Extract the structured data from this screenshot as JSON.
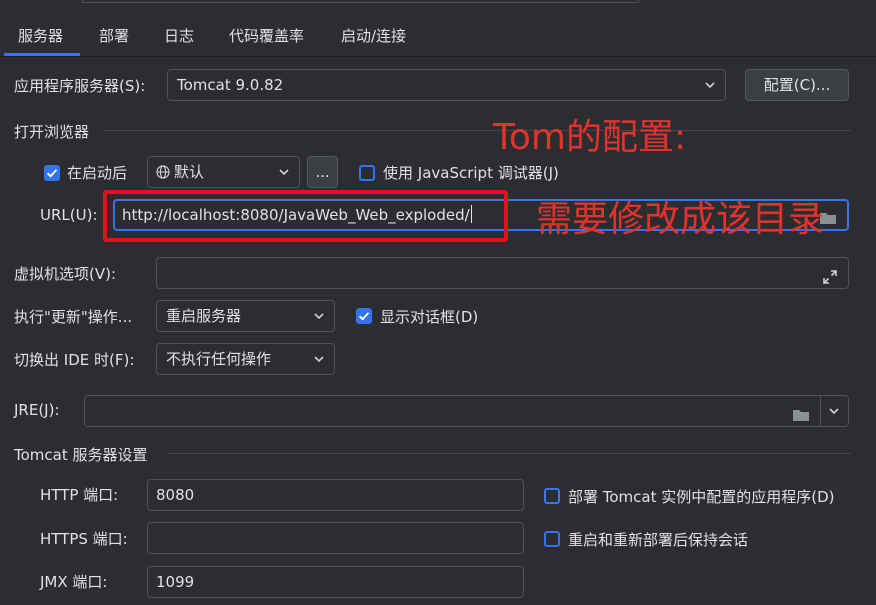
{
  "tabs": [
    "服务器",
    "部署",
    "日志",
    "代码覆盖率",
    "启动/连接"
  ],
  "server": {
    "app_server_label": "应用程序服务器(S):",
    "app_server_value": "Tomcat 9.0.82",
    "config_button": "配置(C)..."
  },
  "browser": {
    "section_title": "打开浏览器",
    "after_launch_label": "在启动后",
    "browser_value": "默认",
    "more_button": "...",
    "js_debugger_label": "使用 JavaScript 调试器(J)",
    "url_label": "URL(U):",
    "url_value": "http://localhost:8080/JavaWeb_Web_exploded/"
  },
  "vm": {
    "label": "虚拟机选项(V):",
    "value": ""
  },
  "update": {
    "label": "执行\"更新\"操作...",
    "value": "重启服务器",
    "show_dialog_label": "显示对话框(D)"
  },
  "frame": {
    "label": "切换出 IDE 时(F):",
    "value": "不执行任何操作"
  },
  "jre": {
    "label": "JRE(J):",
    "value": ""
  },
  "tomcat": {
    "section_title": "Tomcat 服务器设置",
    "http_port_label": "HTTP 端口:",
    "http_port_value": "8080",
    "https_port_label": "HTTPS 端口:",
    "https_port_value": "",
    "jmx_port_label": "JMX 端口:",
    "jmx_port_value": "1099",
    "deploy_label": "部署 Tomcat 实例中配置的应用程序(D)",
    "preserve_sessions_label": "重启和重新部署后保持会话"
  },
  "annotations": {
    "title": "Tom的配置:",
    "note": "需要修改成该目录"
  },
  "checkbox_states": {
    "after_launch": true,
    "js_debugger": false,
    "show_dialog": true,
    "deploy_configured": false,
    "preserve_sessions": false
  },
  "colors": {
    "background": "#2b2d30",
    "accent": "#3574f0",
    "annotation_red": "#e3322b"
  },
  "icons": [
    "globe-icon",
    "folder-icon",
    "expand-icon",
    "chevron-down-icon",
    "check-icon"
  ]
}
